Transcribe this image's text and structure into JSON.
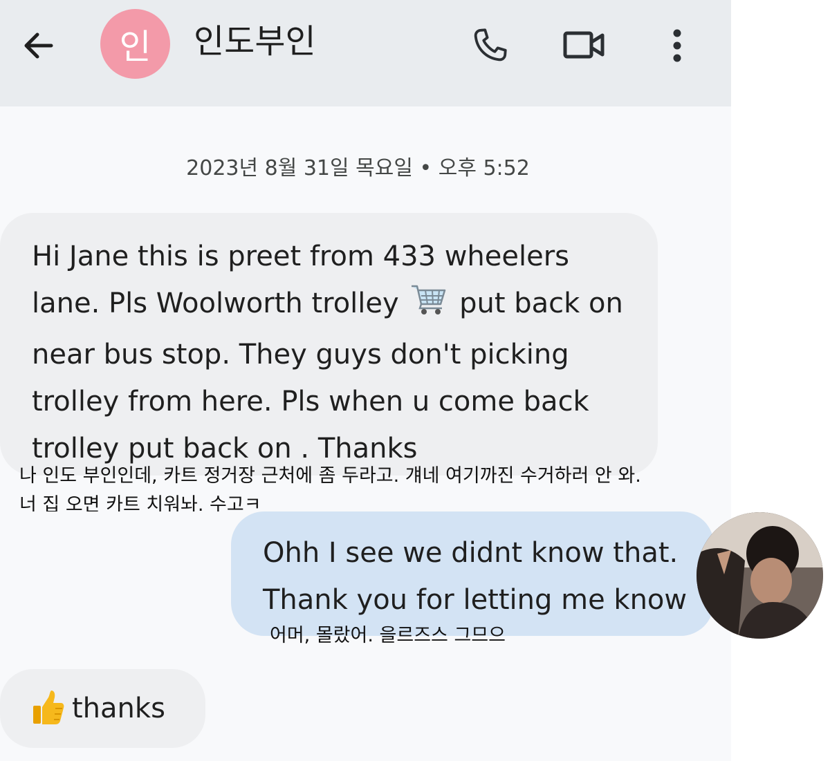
{
  "header": {
    "avatar_letter": "인",
    "contact_name": "인도부인",
    "avatar_color": "#f39aa9",
    "icons": [
      "back-arrow-icon",
      "phone-icon",
      "video-camera-icon",
      "more-vert-icon"
    ]
  },
  "timestamp": "2023년 8월 31일 목요일 • 오후 5:52",
  "messages": [
    {
      "direction": "incoming",
      "lines": [
        "Hi Jane this is preet from 433 wheelers",
        "lane. Pls Woolworth trolley",
        "put back on",
        "near bus stop. They guys don't picking",
        "trolley from here. Pls when u come back",
        "trolley put back on . Thanks"
      ],
      "caption": [
        "나 인도 부인인데, 카트 정거장 근처에 좀 두라고. 걔네 여기까진 수거하러 안 와.",
        "너 집 오면 카트 치워놔. 수고ㅋ"
      ]
    },
    {
      "direction": "outgoing",
      "lines": [
        "Ohh I see we didnt know that.",
        "Thank you for letting me know"
      ],
      "caption": "어머, 몰랐어. 을르즈스 그므으"
    },
    {
      "direction": "incoming",
      "text": "thanks",
      "emoji": "thumbs-up-icon"
    }
  ],
  "colors": {
    "app_bar": "#e9ecef",
    "incoming_bubble": "#eeeff1",
    "outgoing_bubble": "#d3e3f4",
    "background": "#f8f9fb"
  }
}
